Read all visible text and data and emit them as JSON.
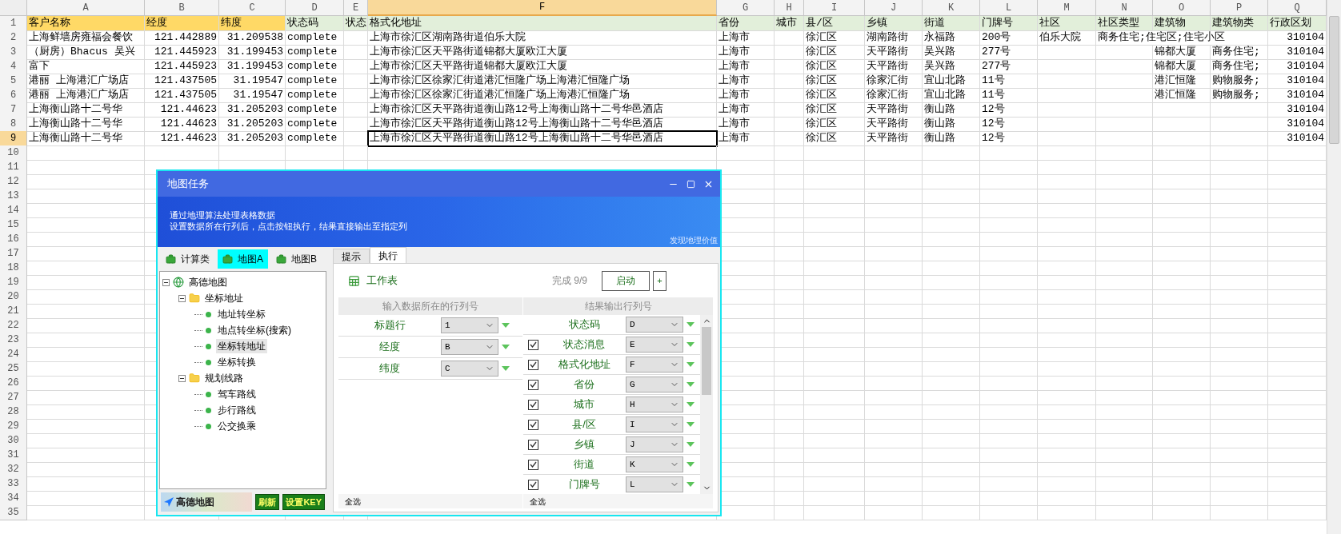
{
  "sheet": {
    "columns": [
      {
        "letter": "A",
        "selected": false
      },
      {
        "letter": "B",
        "selected": false
      },
      {
        "letter": "C",
        "selected": false
      },
      {
        "letter": "D",
        "selected": false
      },
      {
        "letter": "E",
        "selected": false
      },
      {
        "letter": "F",
        "selected": true
      },
      {
        "letter": "G",
        "selected": false
      },
      {
        "letter": "H",
        "selected": false
      },
      {
        "letter": "I",
        "selected": false
      },
      {
        "letter": "J",
        "selected": false
      },
      {
        "letter": "K",
        "selected": false
      },
      {
        "letter": "L",
        "selected": false
      },
      {
        "letter": "M",
        "selected": false
      },
      {
        "letter": "N",
        "selected": false
      },
      {
        "letter": "O",
        "selected": false
      },
      {
        "letter": "P",
        "selected": false
      },
      {
        "letter": "Q",
        "selected": false
      }
    ],
    "rows": [
      {
        "number": "1",
        "kind": "header",
        "selected": false,
        "cells": [
          {
            "text": "客户名称",
            "color": "#ffd966"
          },
          {
            "text": "经度",
            "color": "#ffd966"
          },
          {
            "text": "纬度",
            "color": "#ffd966"
          },
          {
            "text": "状态码",
            "color": "#e2efda"
          },
          {
            "text": "状态",
            "color": "#e2efda"
          },
          {
            "text": "格式化地址",
            "color": "#e2efda"
          },
          {
            "text": "省份",
            "color": "#e2efda"
          },
          {
            "text": "城市",
            "color": "#e2efda"
          },
          {
            "text": "县/区",
            "color": "#e2efda"
          },
          {
            "text": "乡镇",
            "color": "#e2efda"
          },
          {
            "text": "街道",
            "color": "#e2efda"
          },
          {
            "text": "门牌号",
            "color": "#e2efda"
          },
          {
            "text": "社区",
            "color": "#e2efda"
          },
          {
            "text": "社区类型",
            "color": "#e2efda"
          },
          {
            "text": "建筑物",
            "color": "#e2efda"
          },
          {
            "text": "建筑物类",
            "color": "#e2efda"
          },
          {
            "text": "行政区划",
            "color": "#e2efda"
          }
        ]
      },
      {
        "number": "2",
        "kind": "data",
        "selected": false,
        "cells": [
          "上海鲜墙房雍福会餐饮",
          "121.442889",
          "31.209538",
          "complete",
          null,
          "上海市徐汇区湖南路街道伯乐大院",
          "上海市",
          null,
          "徐汇区",
          "湖南路街",
          "永福路",
          "200号",
          "伯乐大院",
          "商务住宅;住宅区;住宅小区",
          null,
          null,
          "310104"
        ]
      },
      {
        "number": "3",
        "kind": "data",
        "selected": false,
        "cells": [
          "（厨房）Bhacus 吴兴",
          "121.445923",
          "31.199453",
          "complete",
          null,
          "上海市徐汇区天平路街道锦都大厦欧江大厦",
          "上海市",
          null,
          "徐汇区",
          "天平路街",
          "吴兴路",
          "277号",
          null,
          null,
          "锦都大厦",
          "商务住宅;",
          "310104"
        ]
      },
      {
        "number": "4",
        "kind": "data",
        "selected": false,
        "cells": [
          "富下",
          "121.445923",
          "31.199453",
          "complete",
          null,
          "上海市徐汇区天平路街道锦都大厦欧江大厦",
          "上海市",
          null,
          "徐汇区",
          "天平路街",
          "吴兴路",
          "277号",
          null,
          null,
          "锦都大厦",
          "商务住宅;",
          "310104"
        ]
      },
      {
        "number": "5",
        "kind": "data",
        "selected": false,
        "cells": [
          "港丽 上海港汇广场店",
          "121.437505",
          "31.19547",
          "complete",
          null,
          "上海市徐汇区徐家汇街道港汇恒隆广场上海港汇恒隆广场",
          "上海市",
          null,
          "徐汇区",
          "徐家汇街",
          "宜山北路",
          "11号",
          null,
          null,
          "港汇恒隆",
          "购物服务;",
          "310104"
        ]
      },
      {
        "number": "6",
        "kind": "data",
        "selected": false,
        "cells": [
          "港丽 上海港汇广场店",
          "121.437505",
          "31.19547",
          "complete",
          null,
          "上海市徐汇区徐家汇街道港汇恒隆广场上海港汇恒隆广场",
          "上海市",
          null,
          "徐汇区",
          "徐家汇街",
          "宜山北路",
          "11号",
          null,
          null,
          "港汇恒隆",
          "购物服务;",
          "310104"
        ]
      },
      {
        "number": "7",
        "kind": "data",
        "selected": false,
        "cells": [
          "上海衡山路十二号华",
          "121.44623",
          "31.205203",
          "complete",
          null,
          "上海市徐汇区天平路街道衡山路12号上海衡山路十二号华邑酒店",
          "上海市",
          null,
          "徐汇区",
          "天平路街",
          "衡山路",
          "12号",
          null,
          null,
          null,
          null,
          "310104"
        ]
      },
      {
        "number": "8",
        "kind": "data",
        "selected": false,
        "cells": [
          "上海衡山路十二号华",
          "121.44623",
          "31.205203",
          "complete",
          null,
          "上海市徐汇区天平路街道衡山路12号上海衡山路十二号华邑酒店",
          "上海市",
          null,
          "徐汇区",
          "天平路街",
          "衡山路",
          "12号",
          null,
          null,
          null,
          null,
          "310104"
        ]
      },
      {
        "number": "9",
        "kind": "data",
        "selected": true,
        "cells": [
          "上海衡山路十二号华",
          "121.44623",
          "31.205203",
          "complete",
          null,
          "上海市徐汇区天平路街道衡山路12号上海衡山路十二号华邑酒店",
          "上海市",
          null,
          "徐汇区",
          "天平路街",
          "衡山路",
          "12号",
          null,
          null,
          null,
          null,
          "310104"
        ]
      },
      {
        "number": "10",
        "kind": "empty",
        "selected": false
      },
      {
        "number": "11",
        "kind": "empty",
        "selected": false
      },
      {
        "number": "12",
        "kind": "empty",
        "selected": false
      },
      {
        "number": "13",
        "kind": "empty",
        "selected": false
      },
      {
        "number": "14",
        "kind": "empty",
        "selected": false
      },
      {
        "number": "15",
        "kind": "empty",
        "selected": false
      },
      {
        "number": "16",
        "kind": "empty",
        "selected": false
      },
      {
        "number": "17",
        "kind": "empty",
        "selected": false
      },
      {
        "number": "18",
        "kind": "empty",
        "selected": false
      },
      {
        "number": "19",
        "kind": "empty",
        "selected": false
      },
      {
        "number": "20",
        "kind": "empty",
        "selected": false
      },
      {
        "number": "21",
        "kind": "empty",
        "selected": false
      },
      {
        "number": "22",
        "kind": "empty",
        "selected": false
      },
      {
        "number": "23",
        "kind": "empty",
        "selected": false
      },
      {
        "number": "24",
        "kind": "empty",
        "selected": false
      },
      {
        "number": "25",
        "kind": "empty",
        "selected": false
      },
      {
        "number": "26",
        "kind": "empty",
        "selected": false
      },
      {
        "number": "27",
        "kind": "empty",
        "selected": false
      },
      {
        "number": "28",
        "kind": "empty",
        "selected": false
      },
      {
        "number": "29",
        "kind": "empty",
        "selected": false
      },
      {
        "number": "30",
        "kind": "empty",
        "selected": false
      },
      {
        "number": "31",
        "kind": "empty",
        "selected": false
      },
      {
        "number": "32",
        "kind": "empty",
        "selected": false
      },
      {
        "number": "33",
        "kind": "empty",
        "selected": false
      },
      {
        "number": "34",
        "kind": "empty",
        "selected": false
      },
      {
        "number": "35",
        "kind": "empty",
        "selected": false
      }
    ]
  },
  "dialog": {
    "title": "地图任务",
    "banner": {
      "lines": [
        "通过地理算法处理表格数据",
        "设置数据所在行列后，点击按钮执行，结果直接输出至指定列"
      ],
      "slogan": "发现地理价值"
    },
    "left_tabs": [
      {
        "label": "计算类",
        "selected": false
      },
      {
        "label": "地图A",
        "selected": true
      },
      {
        "label": "地图B",
        "selected": false
      }
    ],
    "tree": [
      {
        "label": "高德地图",
        "kind": "root",
        "expanded": true,
        "selected": false,
        "children": [
          {
            "label": "坐标地址",
            "kind": "folder",
            "expanded": true,
            "selected": false,
            "children": [
              {
                "label": "地址转坐标",
                "kind": "leaf",
                "selected": false
              },
              {
                "label": "地点转坐标(搜索)",
                "kind": "leaf",
                "selected": false
              },
              {
                "label": "坐标转地址",
                "kind": "leaf",
                "selected": true
              },
              {
                "label": "坐标转换",
                "kind": "leaf",
                "selected": false
              }
            ]
          },
          {
            "label": "规划线路",
            "kind": "folder",
            "expanded": true,
            "selected": false,
            "children": [
              {
                "label": "驾车路线",
                "kind": "leaf",
                "selected": false
              },
              {
                "label": "步行路线",
                "kind": "leaf",
                "selected": false
              },
              {
                "label": "公交换乘",
                "kind": "leaf",
                "selected": false
              }
            ]
          }
        ]
      }
    ],
    "map_logo": "高德地图",
    "footer_buttons": [
      "刷新",
      "设置KEY"
    ],
    "right_tabs": [
      {
        "label": "提示",
        "selected": false
      },
      {
        "label": "执行",
        "selected": true
      }
    ],
    "sheet_label": "工作表",
    "progress": "完成 9/9",
    "start_button": "启动",
    "add_button": "+",
    "input_panel": {
      "header": "输入数据所在的行列号",
      "footer": "全选",
      "rows": [
        {
          "label": "标题行",
          "value": "1"
        },
        {
          "label": "经度",
          "value": "B"
        },
        {
          "label": "纬度",
          "value": "C"
        }
      ]
    },
    "output_panel": {
      "header": "结果输出行列号",
      "footer": "全选",
      "rows": [
        {
          "label": "状态码",
          "value": "D",
          "kind": "fixed"
        },
        {
          "label": "状态消息",
          "value": "E",
          "kind": "checkbox",
          "checked": true
        },
        {
          "label": "格式化地址",
          "value": "F",
          "kind": "checkbox",
          "checked": true
        },
        {
          "label": "省份",
          "value": "G",
          "kind": "checkbox",
          "checked": true
        },
        {
          "label": "城市",
          "value": "H",
          "kind": "checkbox",
          "checked": true
        },
        {
          "label": "县/区",
          "value": "I",
          "kind": "checkbox",
          "checked": true
        },
        {
          "label": "乡镇",
          "value": "J",
          "kind": "checkbox",
          "checked": true
        },
        {
          "label": "街道",
          "value": "K",
          "kind": "checkbox",
          "checked": true
        },
        {
          "label": "门牌号",
          "value": "L",
          "kind": "checkbox",
          "checked": true
        }
      ]
    }
  }
}
